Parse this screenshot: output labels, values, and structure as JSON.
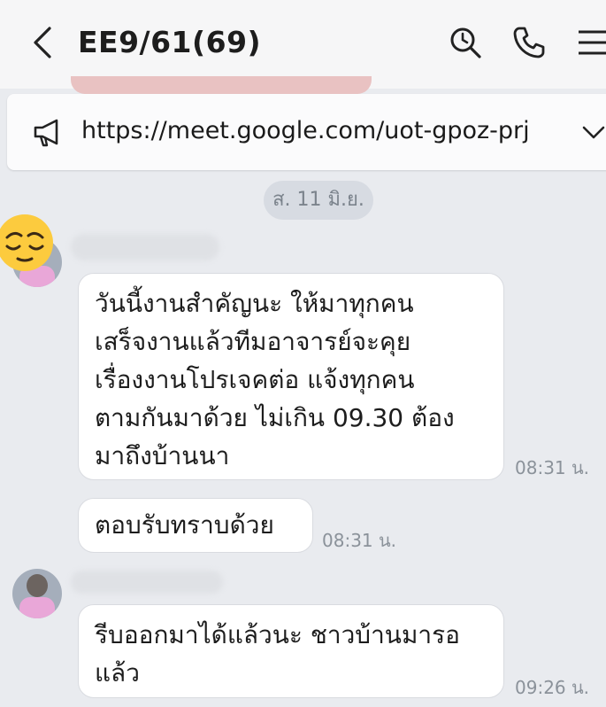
{
  "header": {
    "title": "EE9/61(69)",
    "icons": [
      "back-arrow-icon",
      "search-history-icon",
      "phone-icon",
      "menu-icon"
    ]
  },
  "announcement": {
    "icon": "megaphone-icon",
    "text": "https://meet.google.com/uot-gpoz-prj",
    "expand_icon": "chevron-down-icon"
  },
  "date_divider": "ส. 11 มิ.ย.",
  "messages": [
    {
      "lines": [
        "วันนี้งานสำคัญนะ ให้มาทุกคน",
        "เสร็จงานแล้วทีมอาจารย์จะคุย",
        "เรื่องงานโปรเจคต่อ แจ้งทุกคน",
        "ตามกันมาด้วย ไม่เกิน 09.30 ต้อง",
        "มาถึงบ้านนา"
      ],
      "time": "08:31 น."
    },
    {
      "lines": [
        "ตอบรับทราบด้วย"
      ],
      "time": "08:31 น."
    },
    {
      "lines": [
        "รีบออกมาได้แล้วนะ ชาวบ้านมารอ",
        "แล้ว"
      ],
      "time": "09:26 น."
    }
  ],
  "colors": {
    "background": "#e9ebef",
    "header": "#f6f6f7",
    "bubble": "#ffffff",
    "time_text": "#8b929a",
    "date_pill": "#d7dbe2"
  }
}
